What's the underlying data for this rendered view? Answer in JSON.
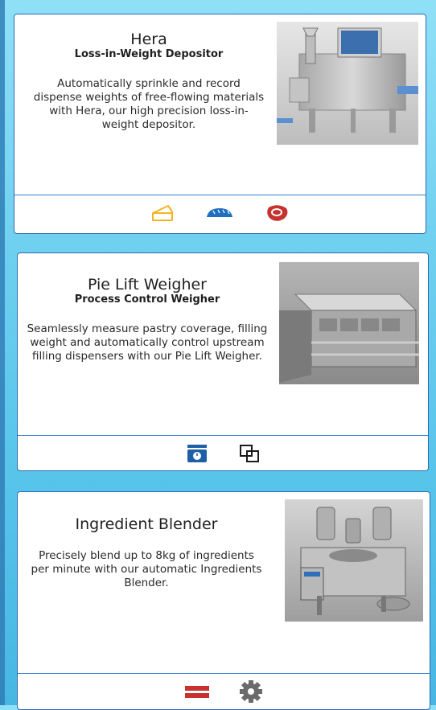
{
  "products": [
    {
      "title": "Hera",
      "subtitle": "Loss-in-Weight Depositor",
      "description": "Automatically sprinkle and record dispense weights of free-flowing materials with Hera, our high precision loss-in-weight depositor.",
      "icons": [
        "cheese-icon",
        "bread-icon",
        "meat-icon"
      ]
    },
    {
      "title": "Pie Lift Weigher",
      "subtitle": "Process Control Weigher",
      "description": "Seamlessly measure pastry coverage, filling weight and automatically control upstream filling dispensers with our Pie Lift Weigher.",
      "icons": [
        "scale-icon",
        "overlap-squares-icon"
      ]
    },
    {
      "title": "Ingredient Blender",
      "subtitle": "",
      "description": "Precisely blend up to 8kg of ingredients per minute with our automatic Ingredients Blender.",
      "icons": [
        "layers-icon",
        "gear-icon"
      ]
    }
  ],
  "colors": {
    "card_border": "#2d69b0",
    "divider": "#2f7fd0",
    "cheese": "#f2b520",
    "bread": "#1e6fc0",
    "meat": "#c8322e",
    "scale": "#1f5fa8",
    "layers": "#c8322e",
    "gear": "#6b6b6b"
  }
}
